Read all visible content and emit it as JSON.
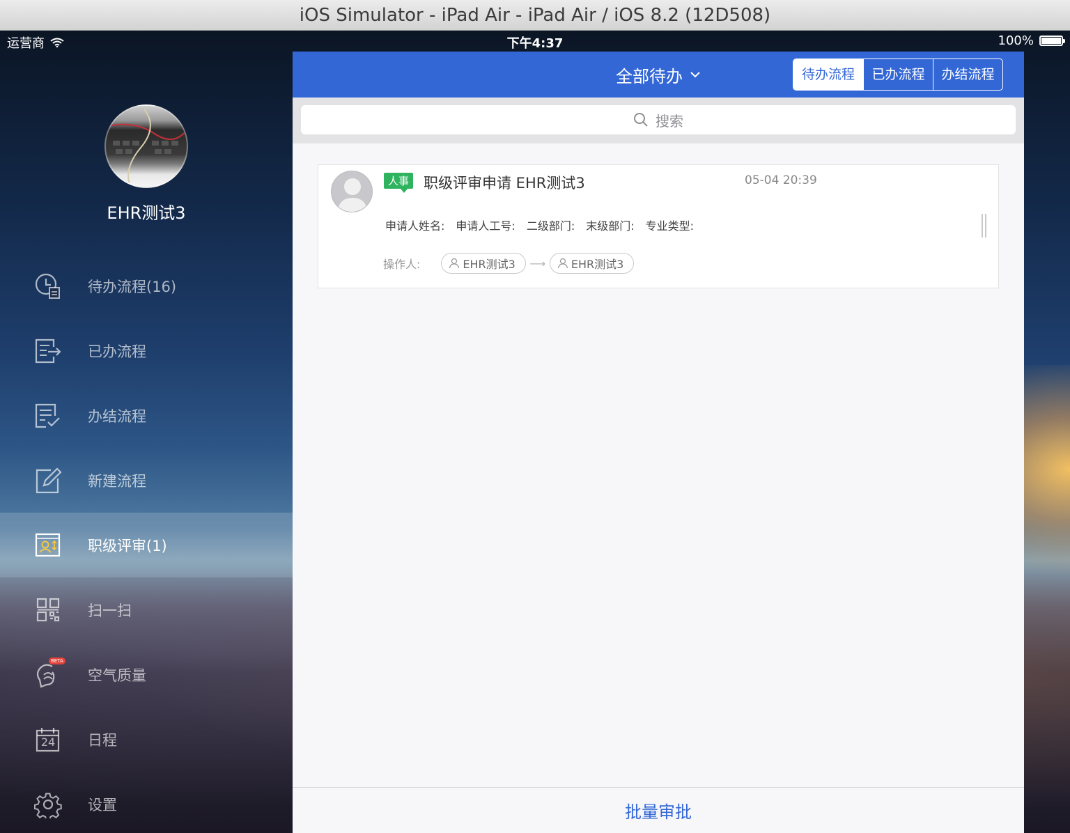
{
  "window": {
    "title": "iOS Simulator - iPad Air - iPad Air / iOS 8.2 (12D508)"
  },
  "status_bar": {
    "carrier": "运营商",
    "time": "下午4:37",
    "battery": "100%"
  },
  "profile": {
    "name": "EHR测试3"
  },
  "menu": [
    {
      "label": "待办流程(16)",
      "icon": "clock-doc-icon",
      "active": false
    },
    {
      "label": "已办流程",
      "icon": "doc-arrow-icon",
      "active": false
    },
    {
      "label": "办结流程",
      "icon": "doc-check-icon",
      "active": false
    },
    {
      "label": "新建流程",
      "icon": "edit-icon",
      "active": false
    },
    {
      "label": "职级评审(1)",
      "icon": "user-review-icon",
      "active": true
    },
    {
      "label": "扫一扫",
      "icon": "qr-code-icon",
      "active": false
    },
    {
      "label": "空气质量",
      "icon": "air-quality-icon",
      "active": false,
      "badge": "BETA"
    },
    {
      "label": "日程",
      "icon": "calendar-icon",
      "active": false,
      "calendar_day": "24"
    },
    {
      "label": "设置",
      "icon": "gear-icon",
      "active": false
    }
  ],
  "navbar": {
    "title": "全部待办",
    "segments": [
      "待办流程",
      "已办流程",
      "办结流程"
    ],
    "selected_segment": "待办流程"
  },
  "search": {
    "placeholder": "搜索"
  },
  "list": [
    {
      "tag": "人事",
      "title": "职级评审申请 EHR测试3",
      "time": "05-04 20:39",
      "fields": [
        "申请人姓名:",
        "申请人工号:",
        "二级部门:",
        "末级部门:",
        "专业类型:"
      ],
      "operator_label": "操作人:",
      "operators": [
        "EHR测试3",
        "EHR测试3"
      ]
    }
  ],
  "bottom_action": "批量审批",
  "colors": {
    "accent": "#3367d6",
    "tag_green": "#2fb35f",
    "beta_red": "#e5443c"
  }
}
